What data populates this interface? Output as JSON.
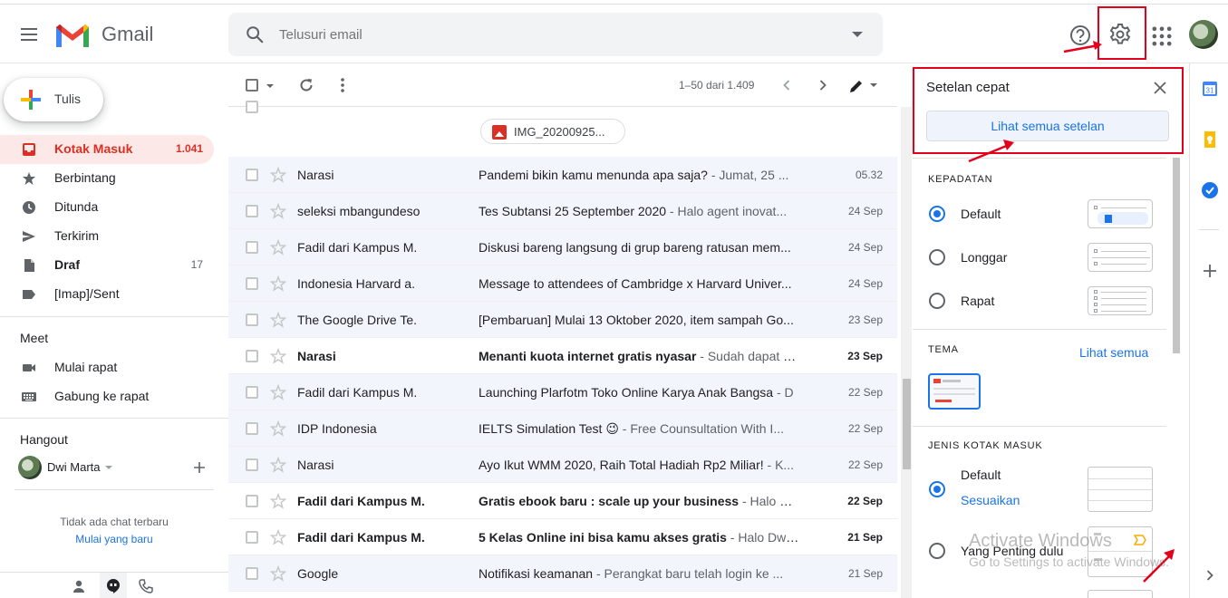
{
  "app": {
    "brand": "Gmail",
    "search_placeholder": "Telusuri email"
  },
  "compose": {
    "label": "Tulis"
  },
  "nav": {
    "items": [
      {
        "label": "Kotak Masuk",
        "count": "1.041",
        "icon": "inbox-icon",
        "active": true
      },
      {
        "label": "Berbintang",
        "count": "",
        "icon": "star-icon"
      },
      {
        "label": "Ditunda",
        "count": "",
        "icon": "clock-icon"
      },
      {
        "label": "Terkirim",
        "count": "",
        "icon": "send-icon"
      },
      {
        "label": "Draf",
        "count": "17",
        "icon": "draft-icon"
      },
      {
        "label": "[Imap]/Sent",
        "count": "",
        "icon": "label-icon"
      }
    ]
  },
  "meet": {
    "title": "Meet",
    "items": [
      {
        "label": "Mulai rapat",
        "icon": "video-icon"
      },
      {
        "label": "Gabung ke rapat",
        "icon": "keyboard-icon"
      }
    ]
  },
  "hangout": {
    "title": "Hangout",
    "user": "Dwi Marta",
    "empty_text": "Tidak ada chat terbaru",
    "start_link": "Mulai yang baru"
  },
  "toolbar": {
    "range": "1–50 dari 1.409"
  },
  "attachment": {
    "name": "IMG_20200925..."
  },
  "emails": [
    {
      "sender": "Narasi",
      "subject": "Pandemi bikin kamu menunda apa saja?",
      "snippet": " - Jumat, 25 ...",
      "date": "05.32",
      "unread": false
    },
    {
      "sender": "seleksi mbangundeso",
      "subject": "Tes Subtansi 25 September 2020",
      "snippet": " - Halo agent inovat...",
      "date": "24 Sep",
      "unread": false
    },
    {
      "sender": "Fadil dari Kampus M.",
      "subject": "Diskusi bareng langsung di grup bareng ratusan mem...",
      "snippet": "",
      "date": "24 Sep",
      "unread": false
    },
    {
      "sender": "Indonesia Harvard a.",
      "subject": "Message to attendees of Cambridge x Harvard Univer...",
      "snippet": "",
      "date": "24 Sep",
      "unread": false
    },
    {
      "sender": "The Google Drive Te.",
      "subject": "[Pembaruan] Mulai 13 Oktober 2020, item sampah Go...",
      "snippet": "",
      "date": "23 Sep",
      "unread": false
    },
    {
      "sender": "Narasi",
      "subject": "Menanti kuota internet gratis nyasar",
      "snippet": " - Sudah dapat k...",
      "date": "23 Sep",
      "unread": true
    },
    {
      "sender": "Fadil dari Kampus M.",
      "subject": "Launching Plarfotm Toko Online Karya Anak Bangsa",
      "snippet": " - D",
      "date": "22 Sep",
      "unread": false
    },
    {
      "sender": "IDP Indonesia",
      "subject": "IELTS Simulation Test 😉",
      "snippet": " - Free Counsultation With I...",
      "date": "22 Sep",
      "unread": false
    },
    {
      "sender": "Narasi",
      "subject": "Ayo Ikut WMM 2020, Raih Total Hadiah Rp2 Miliar!",
      "snippet": " - K...",
      "date": "22 Sep",
      "unread": false
    },
    {
      "sender": "Fadil dari Kampus M.",
      "subject": "Gratis ebook baru : scale up your business",
      "snippet": " - Halo Dw...",
      "date": "22 Sep",
      "unread": true
    },
    {
      "sender": "Fadil dari Kampus M.",
      "subject": "5 Kelas Online ini bisa kamu akses gratis",
      "snippet": " - Halo Dwi ...",
      "date": "21 Sep",
      "unread": true
    },
    {
      "sender": "Google",
      "subject": "Notifikasi keamanan",
      "snippet": " - Perangkat baru telah login ke ...",
      "date": "21 Sep",
      "unread": false
    }
  ],
  "quick_settings": {
    "title": "Setelan cepat",
    "see_all_button": "Lihat semua setelan",
    "density": {
      "heading": "KEPADATAN",
      "options": [
        {
          "label": "Default",
          "selected": true
        },
        {
          "label": "Longgar",
          "selected": false
        },
        {
          "label": "Rapat",
          "selected": false
        }
      ]
    },
    "theme": {
      "heading": "TEMA",
      "see_all": "Lihat semua"
    },
    "inbox_type": {
      "heading": "JENIS KOTAK MASUK",
      "options": [
        {
          "label": "Default",
          "selected": true,
          "link": "Sesuaikan"
        },
        {
          "label": "Yang Penting dulu",
          "selected": false
        }
      ]
    }
  },
  "watermark": {
    "title": "Activate Windows",
    "subtitle": "Go to Settings to activate Windows."
  },
  "colors": {
    "accent": "#1a73e8",
    "inbox_active": "#d93025",
    "highlight_box": "#e2001a"
  }
}
